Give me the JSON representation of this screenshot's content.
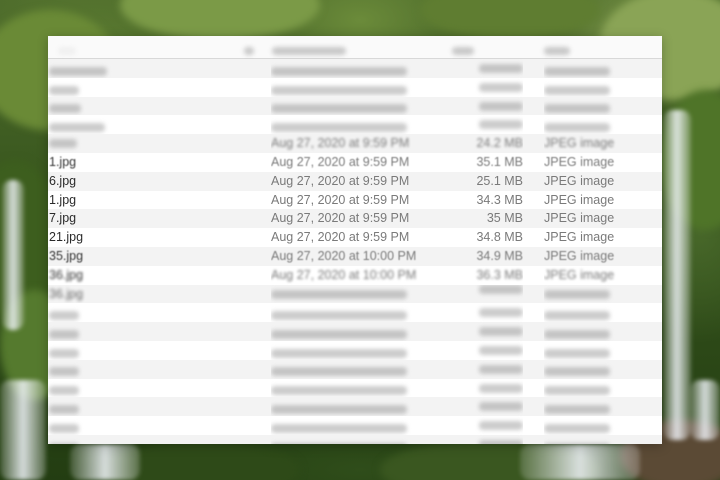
{
  "columns": {
    "name": "Name",
    "date": "Date Modified",
    "size": "Size",
    "kind": "Kind"
  },
  "files": [
    {
      "name": "",
      "date": "",
      "size": "",
      "kind": "",
      "visibility": "obscured"
    },
    {
      "name": "",
      "date": "",
      "size": "",
      "kind": "",
      "visibility": "obscured"
    },
    {
      "name": "",
      "date": "",
      "size": "",
      "kind": "",
      "visibility": "obscured"
    },
    {
      "name": "",
      "date": "",
      "size": "",
      "kind": "",
      "visibility": "obscured"
    },
    {
      "name": "",
      "date": "Aug 27, 2020 at 9:59 PM",
      "size": "24.2 MB",
      "kind": "JPEG image",
      "visibility": "hazy"
    },
    {
      "name": "1.jpg",
      "date": "Aug 27, 2020 at 9:59 PM",
      "size": "35.1 MB",
      "kind": "JPEG image",
      "visibility": "soft"
    },
    {
      "name": "6.jpg",
      "date": "Aug 27, 2020 at 9:59 PM",
      "size": "25.1 MB",
      "kind": "JPEG image",
      "visibility": "sharp"
    },
    {
      "name": "1.jpg",
      "date": "Aug 27, 2020 at 9:59 PM",
      "size": "34.3 MB",
      "kind": "JPEG image",
      "visibility": "sharp"
    },
    {
      "name": "7.jpg",
      "date": "Aug 27, 2020 at 9:59 PM",
      "size": "35 MB",
      "kind": "JPEG image",
      "visibility": "sharp"
    },
    {
      "name": "21.jpg",
      "date": "Aug 27, 2020 at 9:59 PM",
      "size": "34.8 MB",
      "kind": "JPEG image",
      "visibility": "sharp"
    },
    {
      "name": "35.jpg",
      "date": "Aug 27, 2020 at 10:00 PM",
      "size": "34.9 MB",
      "kind": "JPEG image",
      "visibility": "soft"
    },
    {
      "name": "36.jpg",
      "date": "Aug 27, 2020 at 10:00 PM",
      "size": "36.3 MB",
      "kind": "JPEG image",
      "visibility": "hazy"
    },
    {
      "name": "36.jpg",
      "date": "",
      "size": "",
      "kind": "",
      "visibility": "faint"
    },
    {
      "name": "",
      "date": "",
      "size": "",
      "kind": "",
      "visibility": "obscured"
    },
    {
      "name": "",
      "date": "",
      "size": "",
      "kind": "",
      "visibility": "obscured"
    },
    {
      "name": "",
      "date": "",
      "size": "",
      "kind": "",
      "visibility": "obscured"
    },
    {
      "name": "",
      "date": "",
      "size": "",
      "kind": "",
      "visibility": "obscured"
    },
    {
      "name": "",
      "date": "",
      "size": "",
      "kind": "",
      "visibility": "obscured"
    },
    {
      "name": "",
      "date": "",
      "size": "",
      "kind": "",
      "visibility": "obscured"
    },
    {
      "name": "",
      "date": "",
      "size": "",
      "kind": "",
      "visibility": "obscured"
    },
    {
      "name": "",
      "date": "",
      "size": "",
      "kind": "",
      "visibility": "obscured"
    }
  ]
}
